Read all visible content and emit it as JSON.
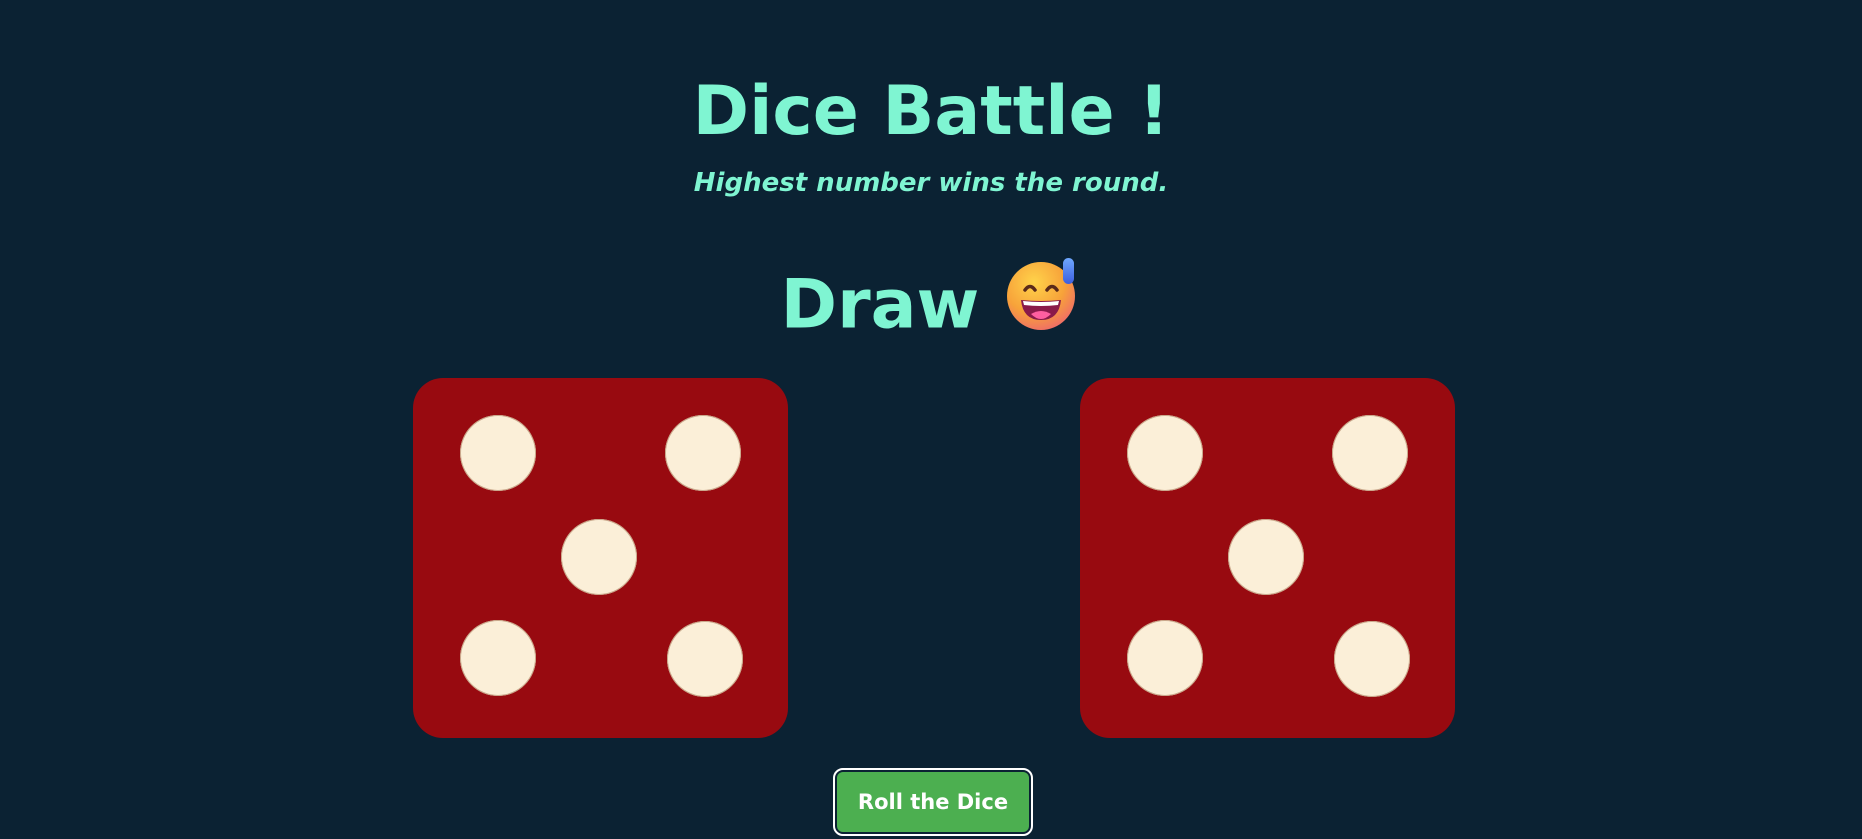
{
  "header": {
    "title": "Dice Battle !",
    "subtitle": "Highest number wins the round."
  },
  "result": {
    "text": "Draw",
    "emoji_icon": "grinning-face-with-sweat-icon"
  },
  "dice": [
    {
      "player": "left",
      "value": 5
    },
    {
      "player": "right",
      "value": 5
    }
  ],
  "controls": {
    "roll_label": "Roll the Dice"
  },
  "colors": {
    "background": "#0b2233",
    "accent_text": "#7ff5d2",
    "die_face": "#980a10",
    "pip": "#fbefd8",
    "button": "#4caf50"
  }
}
